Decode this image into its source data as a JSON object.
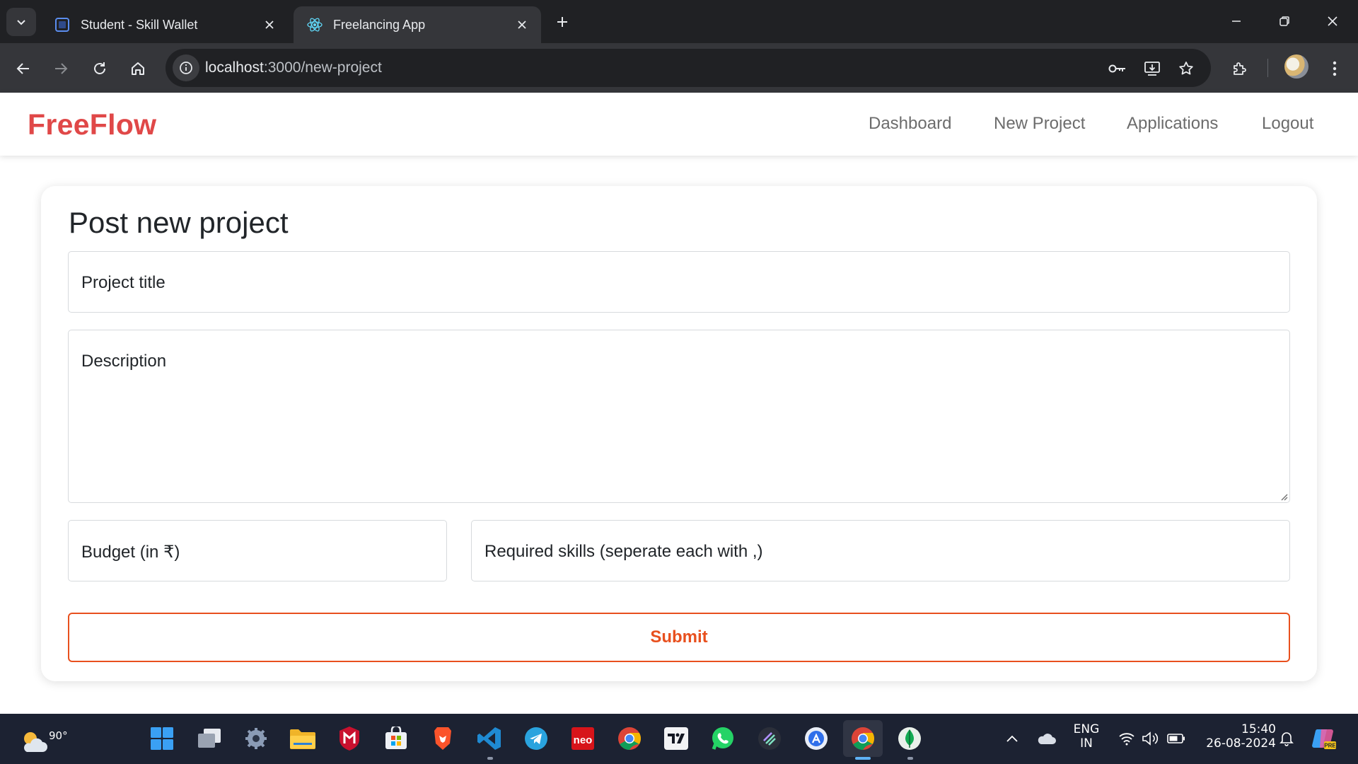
{
  "browser": {
    "tabs": [
      {
        "title": "Student - Skill Wallet",
        "active": false,
        "icon": "skill-wallet-favicon"
      },
      {
        "title": "Freelancing App",
        "active": true,
        "icon": "react-favicon"
      }
    ],
    "address": {
      "host": "localhost",
      "path": ":3000/new-project"
    },
    "accent": "#8ab4f8"
  },
  "navbar": {
    "brand": "FreeFlow",
    "brand_color": "#e04848",
    "links": [
      "Dashboard",
      "New Project",
      "Applications",
      "Logout"
    ]
  },
  "form": {
    "heading": "Post new project",
    "title_placeholder": "Project title",
    "description_placeholder": "Description",
    "budget_placeholder": "Budget (in ₹)",
    "skills_placeholder": "Required skills (seperate each with ,)",
    "submit_label": "Submit",
    "submit_color": "#e8501e"
  },
  "taskbar": {
    "weather": {
      "temp": "90°",
      "icon": "partly-cloudy-icon"
    },
    "apps": [
      "start-icon",
      "task-view-icon",
      "settings-icon",
      "file-explorer-icon",
      "mcafee-icon",
      "microsoft-store-icon",
      "brave-icon",
      "vscode-icon",
      "telegram-icon",
      "neo-icon",
      "chrome-icon",
      "tradingview-icon",
      "whatsapp-icon",
      "linear-icon",
      "app-store-icon",
      "chrome-icon",
      "mongodb-compass-icon"
    ],
    "language": {
      "line1": "ENG",
      "line2": "IN"
    },
    "time": "15:40",
    "date": "26-08-2024"
  }
}
